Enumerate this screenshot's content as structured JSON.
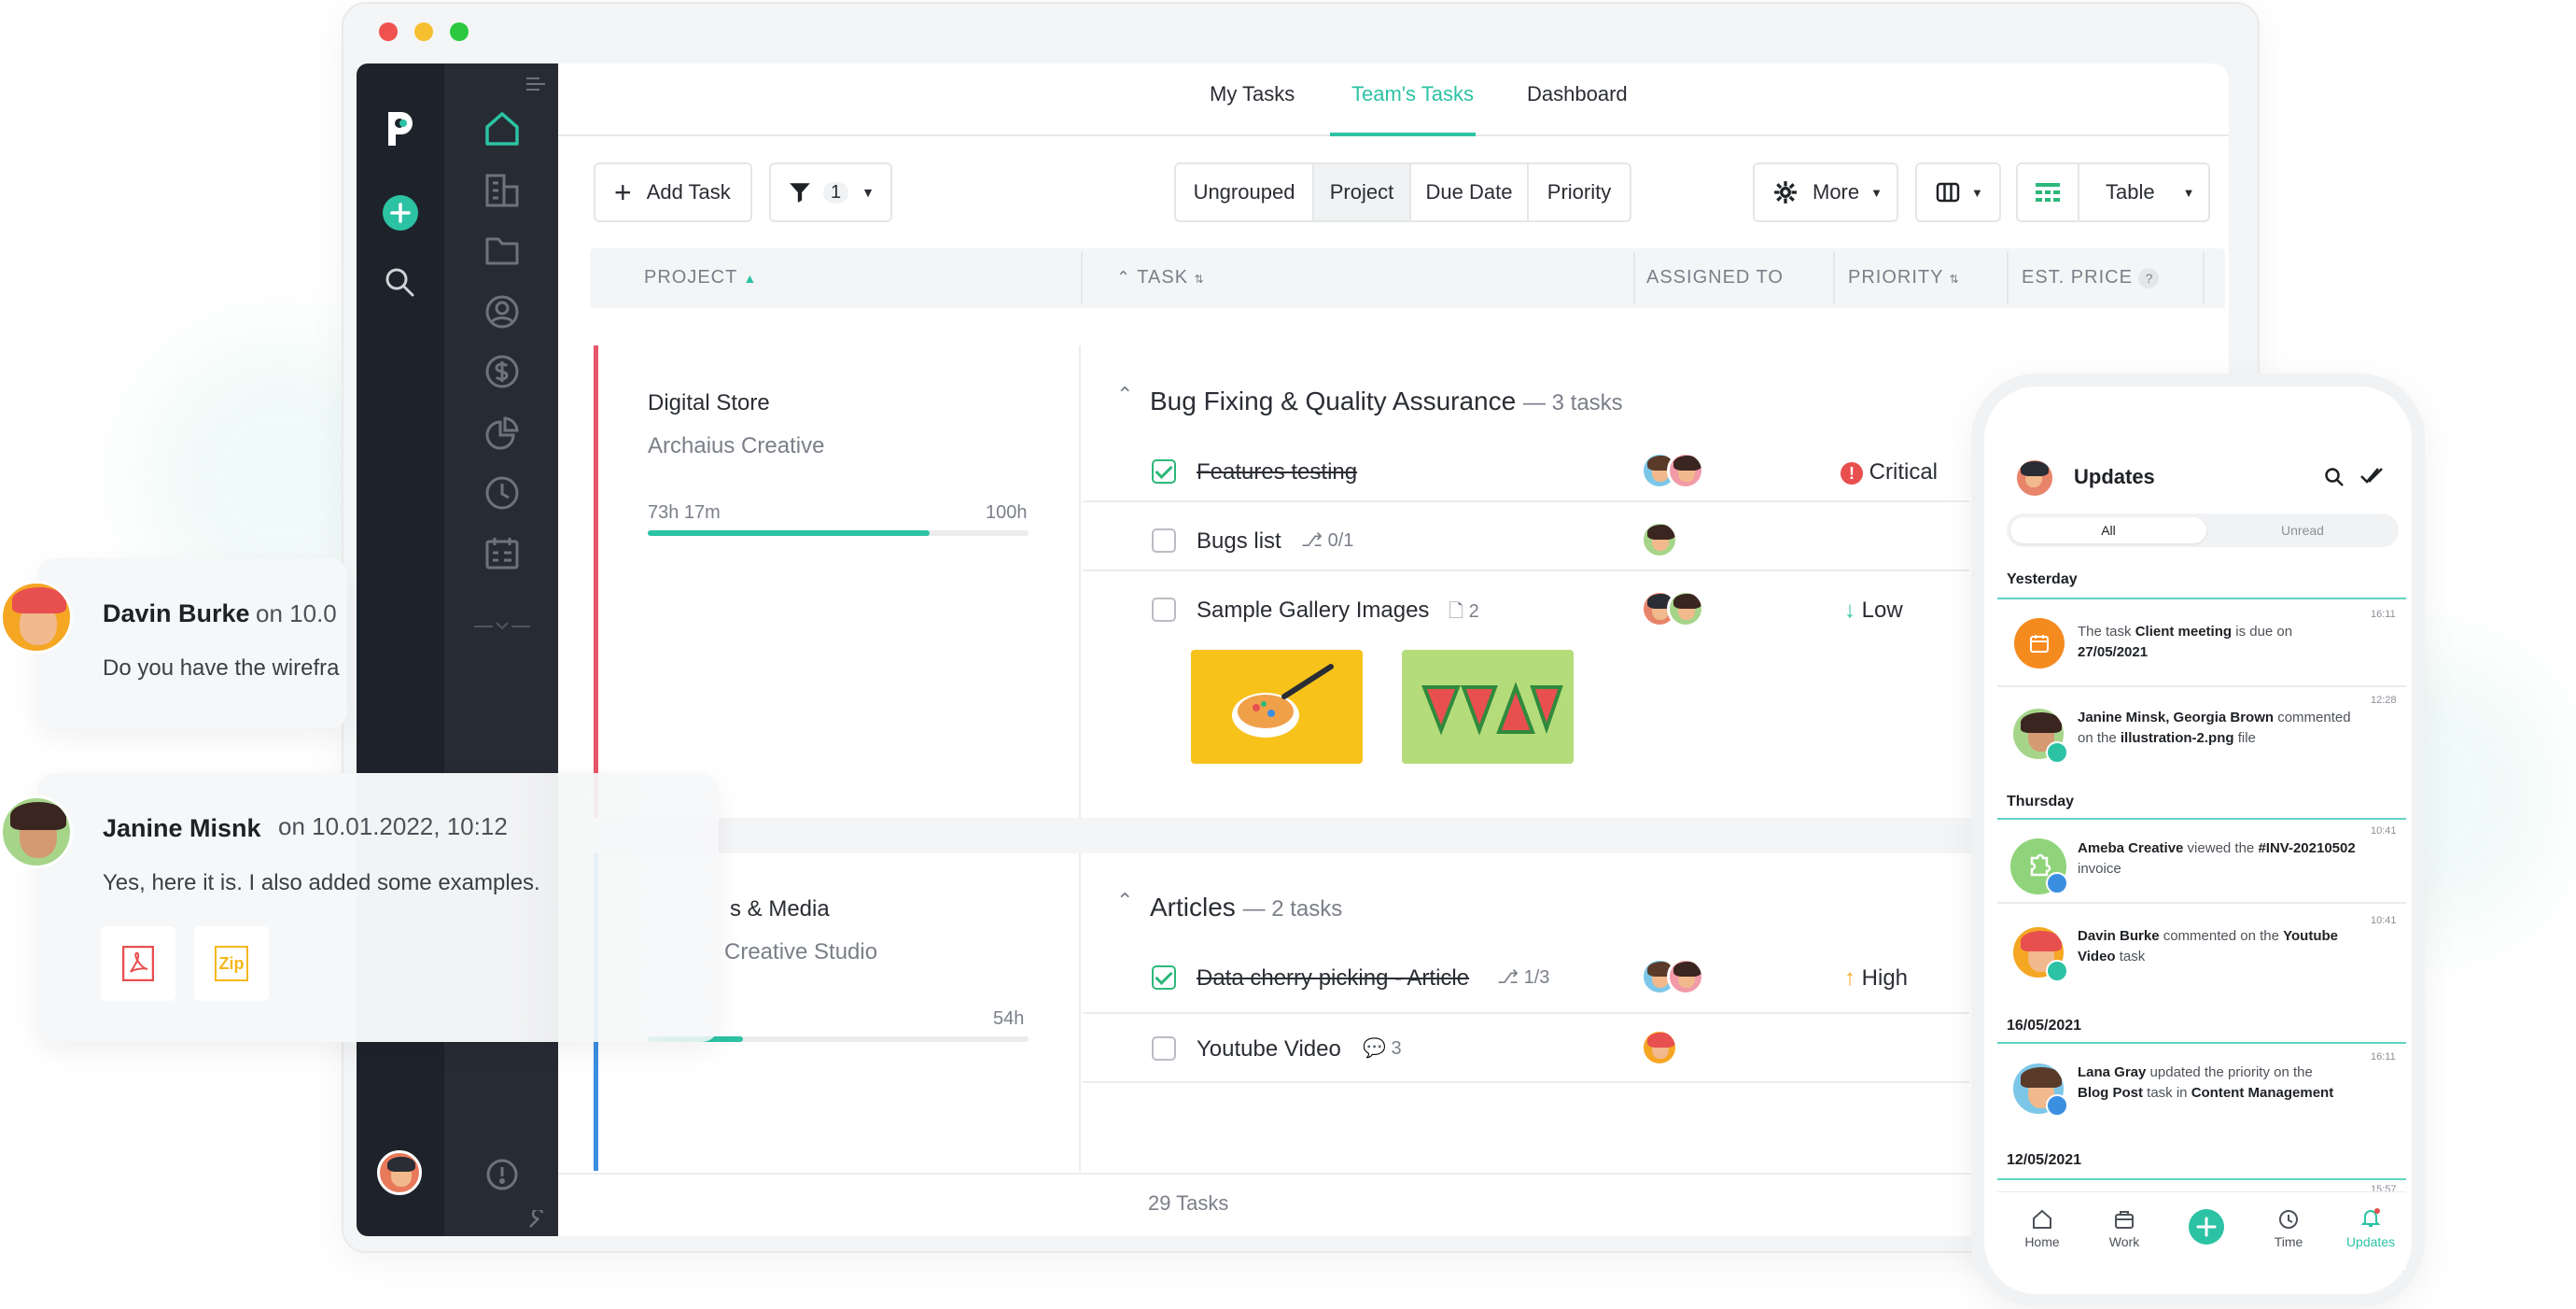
{
  "tabs": [
    "My Tasks",
    "Team's Tasks",
    "Dashboard"
  ],
  "toolbar": {
    "add_task": "Add Task",
    "filter_count": "1",
    "grouping": [
      "Ungrouped",
      "Project",
      "Due Date",
      "Priority"
    ],
    "more": "More",
    "view": "Table"
  },
  "columns": [
    "PROJECT",
    "TASK",
    "ASSIGNED TO",
    "PRIORITY",
    "EST. PRICE",
    "?"
  ],
  "projects": [
    {
      "name": "Digital Store",
      "client": "Archaius Creative",
      "spent": "73h 17m",
      "budget": "100h",
      "progress": 0.74,
      "group": "Bug Fixing & Quality Assurance",
      "group_count": "— 3 tasks"
    },
    {
      "name": "s & Media",
      "client": "Creative Studio",
      "budget": "54h",
      "progress": 0.25,
      "group": "Articles",
      "group_count": "— 2 tasks"
    }
  ],
  "tasks": [
    {
      "name": "Features testing",
      "done": true,
      "priority": "Critical"
    },
    {
      "name": "Bugs list",
      "done": false,
      "meta": "0/1",
      "priority": ""
    },
    {
      "name": "Sample Gallery Images",
      "done": false,
      "meta": "2",
      "priority": "Low"
    },
    {
      "name": "Data cherry picking - Article",
      "done": true,
      "meta": "1/3",
      "priority": "High"
    },
    {
      "name": "Youtube Video",
      "done": false,
      "meta": "3",
      "priority": ""
    }
  ],
  "footer": "29 Tasks",
  "chat": [
    {
      "name": "Davin Burke",
      "date": "on 10.0",
      "message": "Do you have the wirefra"
    },
    {
      "name": "Janine Misnk",
      "date": "on 10.01.2022, 10:12",
      "message": "Yes, here it is. I also added some examples.",
      "attachments": [
        "Zip"
      ]
    }
  ],
  "phone": {
    "title": "Updates",
    "tabs": [
      "All",
      "Unread"
    ],
    "sections": [
      "Yesterday",
      "Thursday",
      "16/05/2021",
      "12/05/2021"
    ],
    "items": [
      {
        "time": "16:11",
        "pre": "The task ",
        "bold1": "Client meeting",
        "mid": " is due on",
        "line2_bold": "27/05/2021",
        "line2": ""
      },
      {
        "time": "12:28",
        "pre": "",
        "bold1": "Janine Minsk, Georgia Brown",
        "mid": " commented",
        "line2_pre": "on the ",
        "line2_bold": "illustration-2.png",
        "line2": " file"
      },
      {
        "time": "10:41",
        "pre": "",
        "bold1": "Ameba Creative",
        "mid": " viewed the ",
        "bold2": "#INV-20210502",
        "line2": "invoice"
      },
      {
        "time": "10:41",
        "pre": "",
        "bold1": "Davin Burke",
        "mid": " commented on the ",
        "bold2": "Youtube",
        "line2_bold": "Video",
        "line2": " task"
      },
      {
        "time": "16:11",
        "pre": "",
        "bold1": "Lana Gray",
        "mid": " updated the priority on the",
        "line2_bold": "Blog Post",
        "line2": " task in ",
        "line2_bold2": "Content Management"
      },
      {
        "time": "15:57"
      }
    ],
    "nav": [
      "Home",
      "Work",
      "Time",
      "Updates"
    ]
  },
  "colors": {
    "accent": "#2cc2a4",
    "critical": "#e84f4f",
    "low": "#2cc2a4",
    "high": "#f5a623",
    "project1_bar": "#e8546a",
    "project2_bar": "#3b8fe0"
  }
}
